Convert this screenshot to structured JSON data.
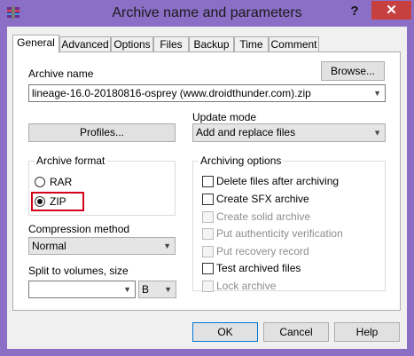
{
  "window": {
    "title": "Archive name and parameters",
    "help_glyph": "?",
    "close_glyph": "✕"
  },
  "tabs": [
    {
      "label": "General",
      "active": true
    },
    {
      "label": "Advanced",
      "active": false
    },
    {
      "label": "Options",
      "active": false
    },
    {
      "label": "Files",
      "active": false
    },
    {
      "label": "Backup",
      "active": false
    },
    {
      "label": "Time",
      "active": false
    },
    {
      "label": "Comment",
      "active": false
    }
  ],
  "general": {
    "archive_name_label": "Archive name",
    "browse_label": "Browse...",
    "archive_name_value": "lineage-16.0-20180816-osprey (www.droidthunder.com).zip",
    "update_mode_label": "Update mode",
    "profiles_label": "Profiles...",
    "update_mode_value": "Add and replace files",
    "archive_format": {
      "title": "Archive format",
      "options": [
        {
          "label": "RAR",
          "selected": false
        },
        {
          "label": "ZIP",
          "selected": true
        }
      ]
    },
    "compression_method_label": "Compression method",
    "compression_method_value": "Normal",
    "split_label": "Split to volumes, size",
    "split_value": "",
    "split_unit": "B",
    "archiving_options": {
      "title": "Archiving options",
      "items": [
        {
          "label": "Delete files after archiving",
          "checked": false,
          "enabled": true
        },
        {
          "label": "Create SFX archive",
          "checked": false,
          "enabled": true
        },
        {
          "label": "Create solid archive",
          "checked": false,
          "enabled": false
        },
        {
          "label": "Put authenticity verification",
          "checked": false,
          "enabled": false
        },
        {
          "label": "Put recovery record",
          "checked": false,
          "enabled": false
        },
        {
          "label": "Test archived files",
          "checked": false,
          "enabled": true
        },
        {
          "label": "Lock archive",
          "checked": false,
          "enabled": false
        }
      ]
    }
  },
  "footer": {
    "ok_label": "OK",
    "cancel_label": "Cancel",
    "help_label": "Help"
  },
  "colors": {
    "titlebar": "#8b6fc6",
    "close_button": "#c74040",
    "highlight_box": "#d0021b"
  }
}
